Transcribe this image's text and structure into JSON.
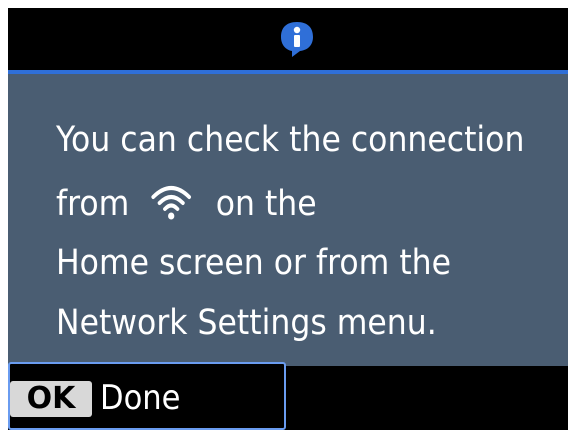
{
  "header": {
    "icon": "info-icon",
    "accent_color": "#2f6fd8"
  },
  "message": {
    "line1": "You can check the connection",
    "line2_before": "from",
    "line2_icon": "wifi-icon",
    "line2_after": "on the",
    "line3": "Home screen or from the",
    "line4": "Network Settings menu."
  },
  "footer": {
    "ok_key_label": "OK",
    "done_label": "Done"
  },
  "colors": {
    "panel_background": "#4a5d72",
    "screen_background": "#000000",
    "text": "#ffffff"
  }
}
